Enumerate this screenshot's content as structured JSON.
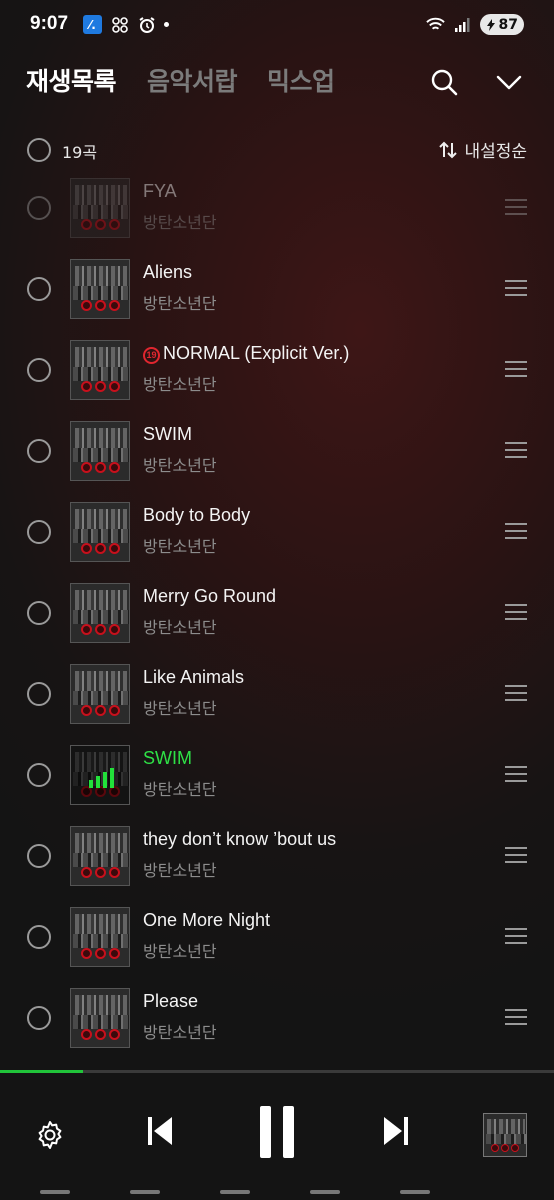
{
  "status_bar": {
    "time": "9:07",
    "battery": "87",
    "icons": [
      "app-blue-icon",
      "grid-app-icon",
      "alarm-icon",
      "notification-dot-icon",
      "wifi-icon",
      "signal-icon",
      "battery-icon"
    ]
  },
  "header": {
    "tabs": [
      "재생목록",
      "음악서랍",
      "믹스업"
    ],
    "active_tab": "재생목록"
  },
  "list_header": {
    "count_label": "19곡",
    "sort_label": "내설정순"
  },
  "tracks": [
    {
      "title": "FYA",
      "artist": "방탄소년단",
      "faded": true
    },
    {
      "title": "Aliens",
      "artist": "방탄소년단"
    },
    {
      "title": "NORMAL (Explicit Ver.)",
      "artist": "방탄소년단",
      "explicit_badge": "19"
    },
    {
      "title": "SWIM",
      "artist": "방탄소년단"
    },
    {
      "title": "Body to Body",
      "artist": "방탄소년단"
    },
    {
      "title": "Merry Go Round",
      "artist": "방탄소년단"
    },
    {
      "title": "Like Animals",
      "artist": "방탄소년단"
    },
    {
      "title": "SWIM",
      "artist": "방탄소년단",
      "now_playing": true
    },
    {
      "title": "they don’t know ’bout us",
      "artist": "방탄소년단"
    },
    {
      "title": "One More Night",
      "artist": "방탄소년단"
    },
    {
      "title": "Please",
      "artist": "방탄소년단"
    }
  ],
  "player": {
    "progress_fraction": 0.15,
    "state": "playing"
  },
  "colors": {
    "accent_green": "#2ee046",
    "explicit_red": "#e0262f",
    "inactive_tab": "#7b7b7b"
  }
}
